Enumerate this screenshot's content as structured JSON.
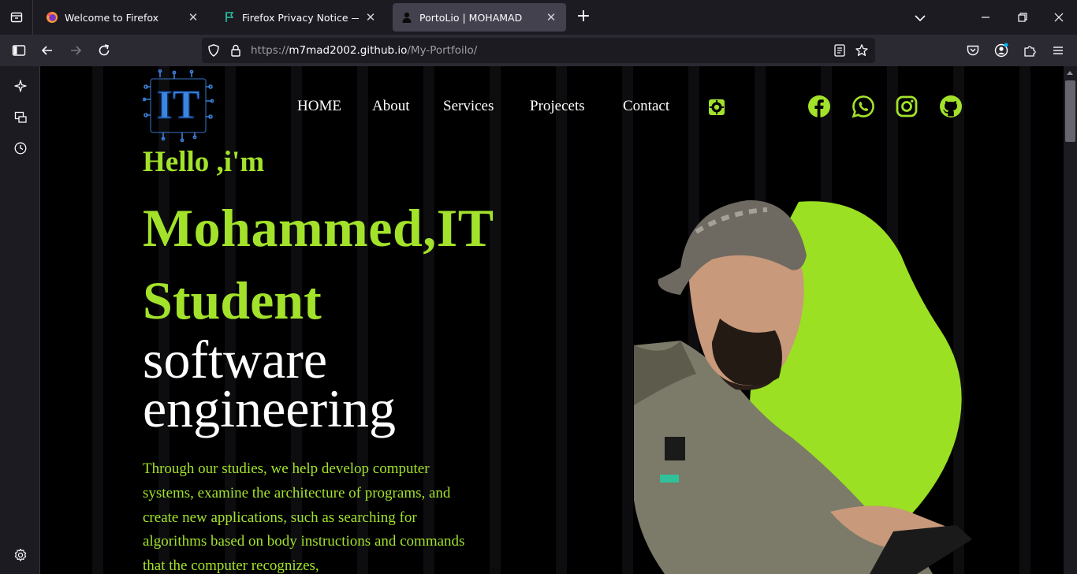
{
  "browser": {
    "tabs": [
      {
        "title": "Welcome to Firefox",
        "active": false
      },
      {
        "title": "Firefox Privacy Notice — Mozill",
        "active": false
      },
      {
        "title": "PortoLio | MOHAMAD",
        "active": true
      }
    ],
    "url": {
      "prefix": "https://",
      "host": "m7mad2002.github.io",
      "path": "/My-Portfoilo/"
    }
  },
  "site": {
    "nav": [
      "HOME",
      "About",
      "Services",
      "Projecets",
      "Contact"
    ],
    "hero": {
      "greeting": "Hello ,i'm",
      "name_line1": "Mohammed,IT",
      "name_line2": "Student",
      "role_line1": "software",
      "role_line2": "engineering",
      "description": "Through our studies, we help develop computer systems, examine the architecture of programs, and create new applications, such as searching for algorithms based on body instructions and commands that the computer recognizes,"
    },
    "social_icons": [
      "facebook-icon",
      "whatsapp-icon",
      "instagram-icon",
      "github-icon"
    ],
    "colors": {
      "accent": "#a3e22a",
      "background": "#000000",
      "text": "#ffffff"
    }
  }
}
